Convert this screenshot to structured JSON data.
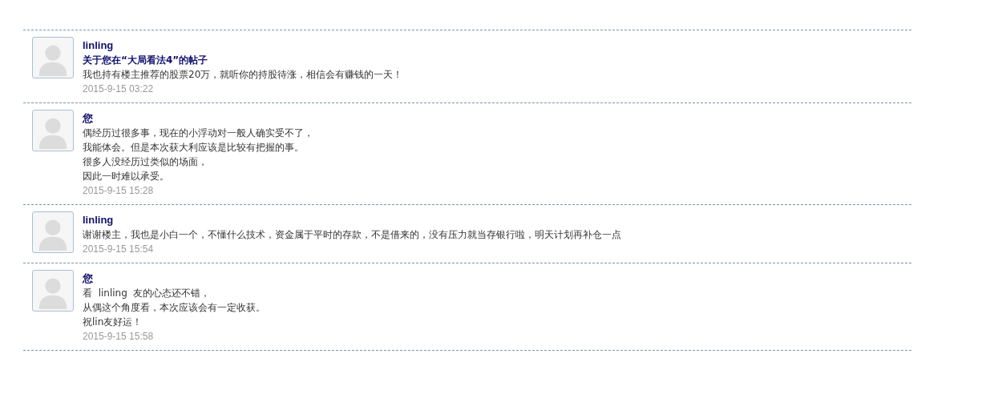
{
  "messages": [
    {
      "author": "linling",
      "subject": "关于您在“大局看法4”的帖子",
      "lines": [
        "我也持有楼主推荐的股票20万，就听你的持股待涨，相信会有赚钱的一天！"
      ],
      "time": "2015-9-15 03:22"
    },
    {
      "author": "您",
      "lines": [
        "偶经历过很多事，现在的小浮动对一般人确实受不了，",
        "我能体会。但是本次获大利应该是比较有把握的事。",
        "很多人没经历过类似的场面，",
        "因此一时难以承受。"
      ],
      "time": "2015-9-15 15:28"
    },
    {
      "author": "linling",
      "lines": [
        "谢谢楼主，我也是小白一个，不懂什么技术，资金属于平时的存款，不是借来的，没有压力就当存银行啦，明天计划再补仓一点"
      ],
      "time": "2015-9-15 15:54"
    },
    {
      "author": "您",
      "lines": [
        "看  linling  友的心态还不错，",
        "从偶这个角度看，本次应该会有一定收获。",
        "祝lin友好运！"
      ],
      "time": "2015-9-15 15:58"
    }
  ]
}
